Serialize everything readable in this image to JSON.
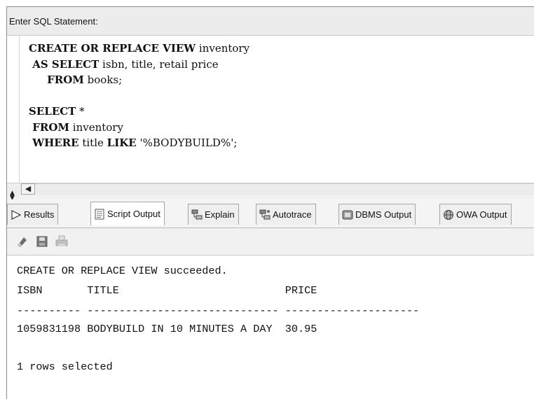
{
  "sql_panel": {
    "header_label": "Enter SQL Statement:",
    "code_lines": [
      [
        {
          "t": "CREATE OR REPLACE VIEW",
          "k": true
        },
        {
          "t": " inventory",
          "k": false
        }
      ],
      [
        {
          "t": " AS SELECT",
          "k": true
        },
        {
          "t": " isbn, title, retail price",
          "k": false
        }
      ],
      [
        {
          "t": "     FROM",
          "k": true
        },
        {
          "t": " books;",
          "k": false
        }
      ],
      [],
      [
        {
          "t": "SELECT",
          "k": true
        },
        {
          "t": " *",
          "k": false
        }
      ],
      [
        {
          "t": " FROM",
          "k": true
        },
        {
          "t": " inventory",
          "k": false
        }
      ],
      [
        {
          "t": " WHERE",
          "k": true
        },
        {
          "t": " title ",
          "k": false
        },
        {
          "t": "LIKE",
          "k": true
        },
        {
          "t": " '%BODYBUILD%';",
          "k": false
        }
      ]
    ]
  },
  "icons": {
    "scroll_left": "arrow-left-icon",
    "splitter": "splitter-arrows-icon",
    "results": "play-triangle-icon",
    "script_output": "document-icon",
    "explain": "explain-plan-icon",
    "autotrace": "autotrace-icon",
    "dbms_output": "dbms-output-icon",
    "owa_output": "globe-icon",
    "clear": "eraser-icon",
    "save": "save-disk-icon",
    "print": "print-icon"
  },
  "tabs": [
    {
      "label": "Results",
      "active": false
    },
    {
      "label": "Script Output",
      "active": true
    },
    {
      "label": "Explain",
      "active": false
    },
    {
      "label": "Autotrace",
      "active": false
    },
    {
      "label": "DBMS Output",
      "active": false
    },
    {
      "label": "OWA Output",
      "active": false
    }
  ],
  "output": {
    "status": "CREATE OR REPLACE VIEW succeeded.",
    "header": "ISBN       TITLE                          PRICE",
    "separator": "---------- ------------------------------ ---------------------",
    "row": "1059831198 BODYBUILD IN 10 MINUTES A DAY  30.95",
    "footer": "1 rows selected"
  },
  "colors": {
    "panel_bg": "#ececec",
    "tab_active_bg": "#ffffff",
    "border": "#a6a6a6"
  }
}
